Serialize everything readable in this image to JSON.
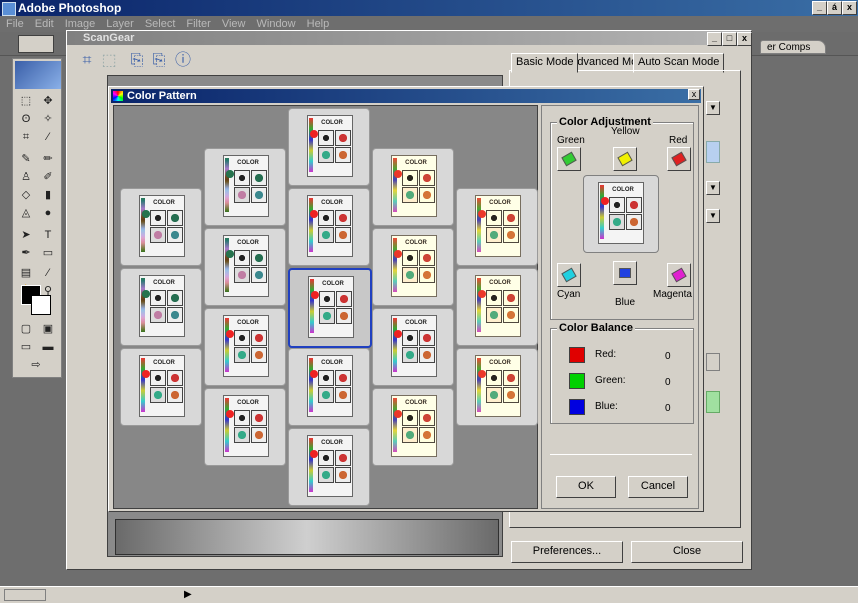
{
  "photoshop": {
    "title": "Adobe Photoshop",
    "menu": [
      "File",
      "Edit",
      "Image",
      "Layer",
      "Select",
      "Filter",
      "View",
      "Window",
      "Help"
    ],
    "window_controls": [
      "_",
      "á",
      "x"
    ]
  },
  "scangear": {
    "title": "ScanGear",
    "tabs": [
      "Basic Mode",
      "Advanced Mode",
      "Auto Scan Mode"
    ],
    "buttons": {
      "preferences": "Preferences...",
      "close": "Close"
    },
    "window_controls": [
      "_",
      "□",
      "x"
    ]
  },
  "layer_comps_tab": "er Comps",
  "color_pattern": {
    "title": "Color Pattern",
    "close": "x",
    "tile_title": "COLOR",
    "adjustment": {
      "title": "Color Adjustment",
      "labels": {
        "yellow": "Yellow",
        "green": "Green",
        "red": "Red",
        "cyan": "Cyan",
        "blue": "Blue",
        "magenta": "Magenta"
      }
    },
    "balance": {
      "title": "Color Balance",
      "rows": [
        {
          "label": "Red:",
          "value": "0",
          "color": "#e00000"
        },
        {
          "label": "Green:",
          "value": "0",
          "color": "#00d000"
        },
        {
          "label": "Blue:",
          "value": "0",
          "color": "#0000e0"
        }
      ]
    },
    "buttons": {
      "ok": "OK",
      "cancel": "Cancel"
    }
  },
  "colors": {
    "accent": "#0a246a",
    "selection": "#2040c0",
    "swatch_green": "#33cc33",
    "swatch_yellow": "#f0f000",
    "swatch_red": "#e02020",
    "swatch_cyan": "#20d0e0",
    "swatch_blue": "#2040e0",
    "swatch_magenta": "#e020d0"
  }
}
